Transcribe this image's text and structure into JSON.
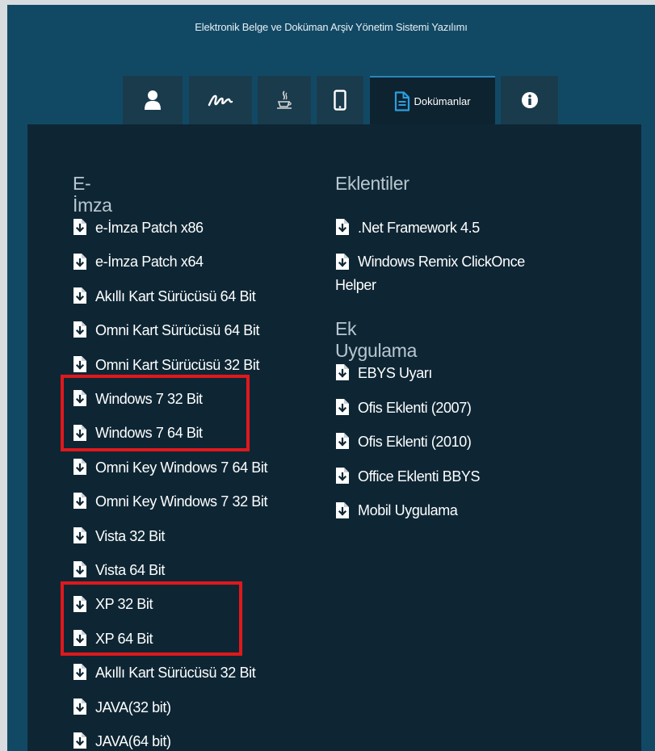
{
  "app": {
    "title": "Elektronik Belge ve Doküman Arşiv Yönetim Sistemi Yazılımı"
  },
  "tabs": [
    {
      "icon": "user-icon",
      "label": ""
    },
    {
      "icon": "signature-icon",
      "label": ""
    },
    {
      "icon": "java-icon",
      "label": ""
    },
    {
      "icon": "mobile-icon",
      "label": ""
    },
    {
      "icon": "document-icon",
      "label": "Dokümanlar",
      "active": true
    },
    {
      "icon": "info-icon",
      "label": ""
    }
  ],
  "eimza": {
    "heading": "E-İmza",
    "items": [
      "e-İmza Patch x86",
      "e-İmza Patch x64",
      "Akıllı Kart Sürücüsü 64 Bit",
      "Omni Kart Sürücüsü 64 Bit",
      "Omni Kart Sürücüsü 32 Bit",
      "Windows 7 32 Bit",
      "Windows 7 64 Bit",
      "Omni Key Windows 7 64 Bit",
      "Omni Key Windows 7 32 Bit",
      "Vista 32 Bit",
      "Vista 64 Bit",
      "XP 32 Bit",
      "XP 64 Bit",
      "Akıllı Kart Sürücüsü 32 Bit",
      "JAVA(32 bit)",
      "JAVA(64 bit)"
    ]
  },
  "eklentiler": {
    "heading": "Eklentiler",
    "items": [
      ".Net Framework 4.5",
      "Windows Remix ClickOnce Helper"
    ]
  },
  "ek_uygulama": {
    "heading": "Ek Uygulama",
    "items": [
      "EBYS Uyarı",
      "Ofis Eklenti (2007)",
      "Ofis Eklenti (2010)",
      "Office Eklenti BBYS",
      "Mobil Uygulama"
    ]
  },
  "colors": {
    "page_bg": "#114965",
    "panel_bg": "#0e2634",
    "tab_bg": "#1a3b4c",
    "highlight": "#e0181c"
  }
}
